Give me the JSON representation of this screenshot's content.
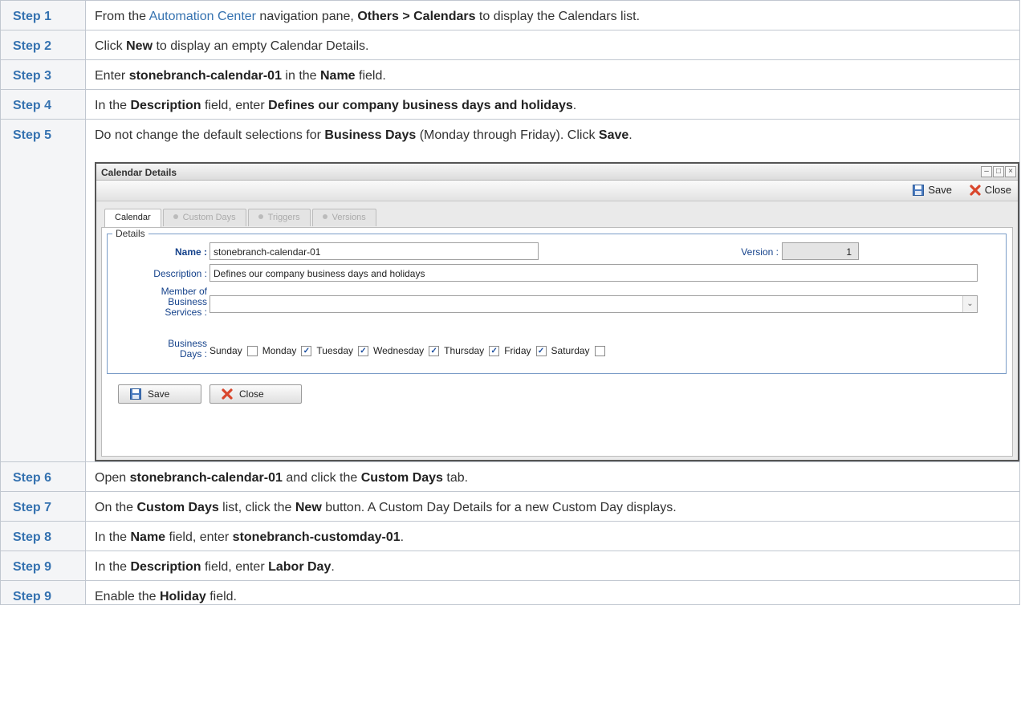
{
  "steps": [
    {
      "label": "Step 1",
      "pre": "From the ",
      "link": "Automation Center",
      "mid": " navigation pane, ",
      "b1": "Others > Calendars",
      "post": " to display the Calendars list."
    },
    {
      "label": "Step 2",
      "pre": "Click ",
      "b1": "New",
      "post": " to display an empty Calendar Details."
    },
    {
      "label": "Step 3",
      "pre": "Enter ",
      "b1": "stonebranch-calendar-01",
      "mid": " in the ",
      "b2": "Name",
      "post": " field."
    },
    {
      "label": "Step 4",
      "pre": "In the ",
      "b1": "Description",
      "mid": " field, enter ",
      "b2": "Defines our company business days and holidays",
      "post": "."
    },
    {
      "label": "Step 5",
      "pre": "Do not change the default selections for ",
      "b1": "Business Days",
      "mid": " (Monday through Friday). Click ",
      "b2": "Save",
      "post": "."
    },
    {
      "label": "Step 6",
      "pre": "Open ",
      "b1": "stonebranch-calendar-01",
      "mid": " and click the ",
      "b2": "Custom Days",
      "post": " tab."
    },
    {
      "label": "Step 7",
      "pre": "On the ",
      "b1": "Custom Days",
      "mid": " list, click the ",
      "b2": "New",
      "post": " button. A Custom Day Details for a new Custom Day displays."
    },
    {
      "label": "Step 8",
      "pre": "In the ",
      "b1": "Name",
      "mid": " field, enter ",
      "b2": "stonebranch-customday-01",
      "post": "."
    },
    {
      "label": "Step 9",
      "pre": "In the ",
      "b1": "Description",
      "mid": " field, enter ",
      "b2": "Labor Day",
      "post": "."
    },
    {
      "label": "Step 9",
      "pre": "Enable the ",
      "b1": "Holiday",
      "post": " field."
    }
  ],
  "dialog": {
    "title": "Calendar Details",
    "toolbar": {
      "save": "Save",
      "close": "Close"
    },
    "tabs": [
      "Calendar",
      "Custom Days",
      "Triggers",
      "Versions"
    ],
    "legend": "Details",
    "fields": {
      "name_label": "Name :",
      "name_value": "stonebranch-calendar-01",
      "version_label": "Version :",
      "version_value": "1",
      "description_label": "Description :",
      "description_value": "Defines our company business days and holidays",
      "member_label_1": "Member of",
      "member_label_2": "Business",
      "member_label_3": "Services :",
      "member_value": "",
      "business_days_label_1": "Business",
      "business_days_label_2": "Days :"
    },
    "days": [
      {
        "name": "Sunday",
        "checked": false
      },
      {
        "name": "Monday",
        "checked": true
      },
      {
        "name": "Tuesday",
        "checked": true
      },
      {
        "name": "Wednesday",
        "checked": true
      },
      {
        "name": "Thursday",
        "checked": true
      },
      {
        "name": "Friday",
        "checked": true
      },
      {
        "name": "Saturday",
        "checked": false
      }
    ],
    "buttons": {
      "save": "Save",
      "close": "Close"
    },
    "window_buttons": {
      "minimize": "–",
      "maximize": "□",
      "close": "×"
    }
  },
  "colors": {
    "step_label": "#3572b0",
    "link": "#3572b0",
    "field_label": "#15428b"
  }
}
